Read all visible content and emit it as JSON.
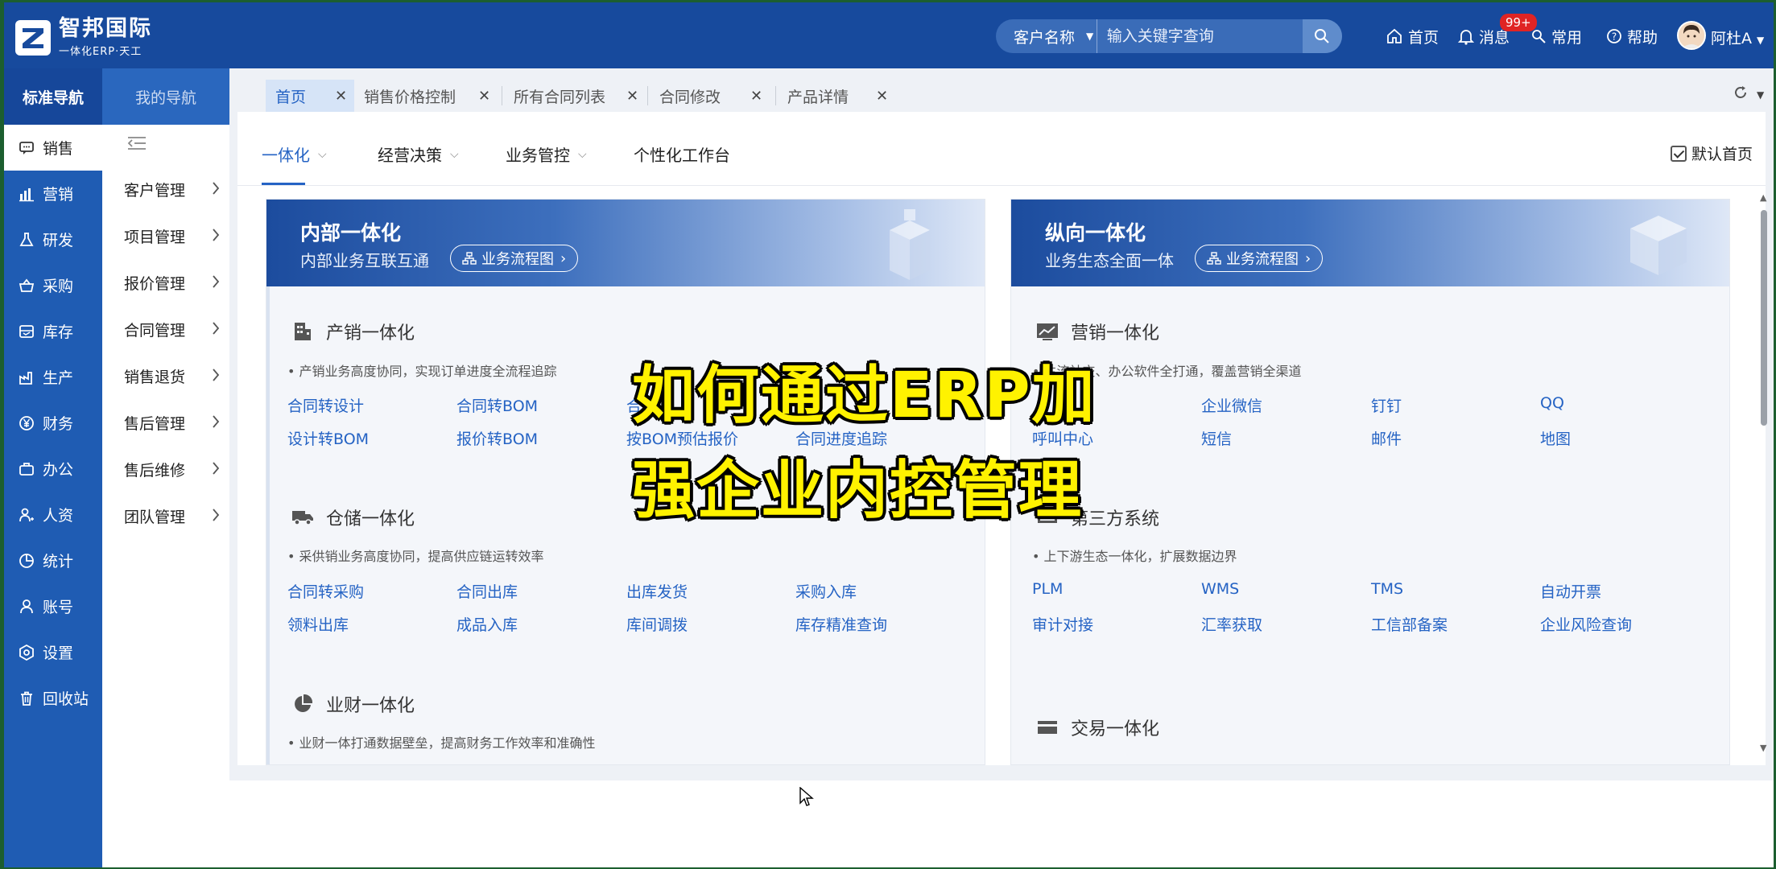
{
  "app": {
    "logo_name": "智邦国际",
    "logo_sub": "一体化ERP·天工"
  },
  "search": {
    "category": "客户名称",
    "placeholder": "输入关键字查询"
  },
  "top_nav": {
    "home": "首页",
    "messages": "消息",
    "messages_badge": "99+",
    "common": "常用",
    "help": "帮助",
    "user": "阿杜A"
  },
  "nav_tabs": {
    "standard": "标准导航",
    "mine": "我的导航"
  },
  "sidebar": [
    {
      "label": "销售",
      "icon": "chat-icon",
      "active": true
    },
    {
      "label": "营销",
      "icon": "bar-chart-icon"
    },
    {
      "label": "研发",
      "icon": "flask-icon"
    },
    {
      "label": "采购",
      "icon": "basket-icon"
    },
    {
      "label": "库存",
      "icon": "inventory-icon"
    },
    {
      "label": "生产",
      "icon": "factory-icon"
    },
    {
      "label": "财务",
      "icon": "yen-icon"
    },
    {
      "label": "办公",
      "icon": "briefcase-icon"
    },
    {
      "label": "人资",
      "icon": "people-icon"
    },
    {
      "label": "统计",
      "icon": "pie-icon"
    },
    {
      "label": "账号",
      "icon": "person-icon"
    },
    {
      "label": "设置",
      "icon": "settings-icon"
    },
    {
      "label": "回收站",
      "icon": "trash-icon"
    }
  ],
  "submenu": [
    "客户管理",
    "项目管理",
    "报价管理",
    "合同管理",
    "销售退货",
    "售后管理",
    "售后维修",
    "团队管理"
  ],
  "page_tabs": [
    "首页",
    "销售价格控制",
    "所有合同列表",
    "合同修改",
    "产品详情"
  ],
  "section_tabs": [
    "一体化",
    "经营决策",
    "业务管控",
    "个性化工作台"
  ],
  "default_home": "默认首页",
  "cards": {
    "left": {
      "title": "内部一体化",
      "subtitle": "内部业务互联互通",
      "flow_button": "业务流程图",
      "groups": [
        {
          "title": "产销一体化",
          "desc": "• 产销业务高度协同，实现订单进度全流程追踪",
          "links": [
            "合同转设计",
            "合同转BOM",
            "合",
            "设计转BOM",
            "报价转BOM",
            "按BOM预估报价",
            "合同进度追踪"
          ]
        },
        {
          "title": "仓储一体化",
          "desc": "• 采供销业务高度协同，提高供应链运转效率",
          "links": [
            "合同转采购",
            "合同出库",
            "出库发货",
            "采购入库",
            "领料出库",
            "成品入库",
            "库间调拨",
            "库存精准查询"
          ]
        },
        {
          "title": "业财一体化",
          "desc": "• 业财一体打通数据壁垒，提高财务工作效率和准确性"
        }
      ]
    },
    "right": {
      "title": "纵向一体化",
      "subtitle": "业务生态全面一体",
      "flow_button": "业务流程图",
      "groups": [
        {
          "title": "营销一体化",
          "desc": "• 主流社交、办公软件全打通，覆盖营销全渠道",
          "links": [
            "企业微信",
            "钉钉",
            "QQ",
            "呼叫中心",
            "短信",
            "邮件",
            "地图"
          ]
        },
        {
          "title": "第三方系统",
          "desc": "• 上下游生态一体化，扩展数据边界",
          "links": [
            "PLM",
            "WMS",
            "TMS",
            "自动开票",
            "审计对接",
            "汇率获取",
            "工信部备案",
            "企业风险查询"
          ]
        },
        {
          "title": "交易一体化"
        }
      ]
    }
  },
  "overlay_caption": [
    "如何通过ERP加",
    "强企业内控管理"
  ],
  "colors": {
    "brand_blue": "#174a9d",
    "sidebar_blue": "#1f5cb3",
    "link_blue": "#2563c4",
    "badge_red": "#e02424",
    "caption_yellow": "#fff200"
  }
}
